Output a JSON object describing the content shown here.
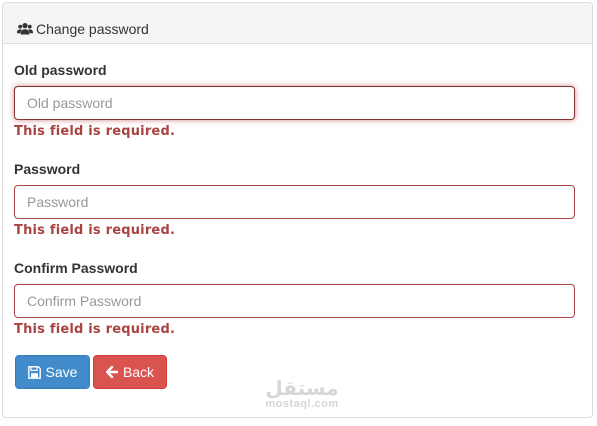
{
  "panel": {
    "title": "Change password",
    "title_icon": "users-icon"
  },
  "fields": [
    {
      "label": "Old password",
      "placeholder": "Old password",
      "value": "",
      "error": "This field is required.",
      "focused": true
    },
    {
      "label": "Password",
      "placeholder": "Password",
      "value": "",
      "error": "This field is required.",
      "focused": false
    },
    {
      "label": "Confirm Password",
      "placeholder": "Confirm Password",
      "value": "",
      "error": "This field is required.",
      "focused": false
    }
  ],
  "buttons": {
    "save_label": "Save",
    "save_icon": "floppy-disk-icon",
    "back_label": "Back",
    "back_icon": "arrow-left-icon"
  },
  "colors": {
    "error": "#a94442",
    "primary": "#428bca",
    "danger": "#d9534f",
    "heading_bg": "#f5f5f5"
  },
  "watermark": {
    "arabic": "مستقل",
    "latin": "mostaql.com"
  }
}
